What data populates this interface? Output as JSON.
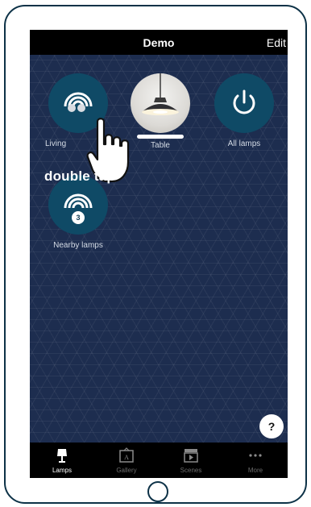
{
  "nav": {
    "title": "Demo",
    "edit_label": "Edit"
  },
  "tiles": [
    {
      "label": "Living",
      "icon": "wifi-lamp-icon"
    },
    {
      "label": "Table",
      "icon": "pendant-lamp-photo"
    },
    {
      "label": "All lamps",
      "icon": "power-icon"
    },
    {
      "label": "Nearby lamps",
      "icon": "nearby-signal-icon",
      "badge": "3"
    }
  ],
  "gesture": {
    "text": "double tap",
    "icon": "tap-hand-icon"
  },
  "help": {
    "label": "?"
  },
  "tabs": [
    {
      "label": "Lamps",
      "icon": "lamp-icon",
      "active": true
    },
    {
      "label": "Gallery",
      "icon": "gallery-icon"
    },
    {
      "label": "Scenes",
      "icon": "clapperboard-icon"
    },
    {
      "label": "More",
      "icon": "more-dots-icon"
    }
  ],
  "colors": {
    "screen_bg": "#1d2d4f",
    "tile_circle": "#0f4a66",
    "device_border": "#0d3247",
    "bar_bg": "#000000"
  }
}
